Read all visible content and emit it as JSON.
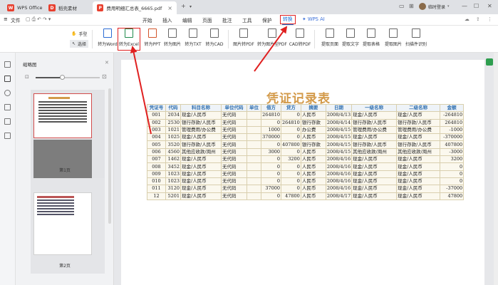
{
  "titlebar": {
    "tabs": [
      {
        "label": "WPS Office",
        "icon": "wps-logo-icon",
        "color": "#e8402f"
      },
      {
        "label": "稻壳素材",
        "icon": "docer-logo-icon",
        "color": "#e8402f"
      },
      {
        "label": "费用明细汇总表_6665.pdf",
        "icon": "pdf-file-icon",
        "color": "#e8402f",
        "active": true
      }
    ],
    "new_tab": "+",
    "user_name": "临时登录"
  },
  "menu": {
    "file_label": "文件",
    "items": [
      "开始",
      "插入",
      "编辑",
      "页面",
      "批注",
      "工具",
      "保护",
      "转换",
      "WPS AI"
    ],
    "active": "转换"
  },
  "toolbar": {
    "hand": "手型",
    "select": "选择",
    "tools_group1": [
      "转为Word",
      "转为Excel",
      "转为PPT",
      "转为图片",
      "转为TXT",
      "转为CAD"
    ],
    "tools_group2": [
      "图片转PDF",
      "转为图片型PDF",
      "CAD转PDF"
    ],
    "tools_group3": [
      "提取页面",
      "提取文字",
      "提取表格",
      "提取图片",
      "扫描件识别"
    ]
  },
  "thumbnails": {
    "title": "缩略图",
    "pages": [
      {
        "label": "第1页",
        "selected": true
      },
      {
        "label": "第2页",
        "selected": false
      }
    ]
  },
  "document": {
    "title": "凭证记录表",
    "headers": [
      "凭证号",
      "代码",
      "科目名称",
      "单位代码",
      "单位",
      "借方",
      "贷方",
      "摘要",
      "日期",
      "一级名称",
      "二级名称",
      "金额"
    ],
    "rows": [
      [
        "001",
        "2034",
        "现金/人民币",
        "无代码",
        "",
        "264810",
        "0",
        "人民币",
        "2008/4/13",
        "现金/人民币",
        "现金/人民币",
        "-264810"
      ],
      [
        "002",
        "2530",
        "银行存款/人民币",
        "无代码",
        "",
        "0",
        "264810",
        "银行存款",
        "2008/4/14",
        "银行存款/人民币",
        "银行存款/人民币",
        "264810"
      ],
      [
        "003",
        "1021",
        "管理费用/办公费",
        "无代码",
        "",
        "1000",
        "0",
        "办公费",
        "2008/4/15",
        "管理费用/办公费",
        "管理费用/办公费",
        "-1000"
      ],
      [
        "004",
        "1025",
        "现金/人民币",
        "无代码",
        "",
        "370000",
        "0",
        "人民币",
        "2008/4/15",
        "现金/人民币",
        "现金/人民币",
        "-370000"
      ],
      [
        "005",
        "3520",
        "银行存款/人民币",
        "无代码",
        "",
        "0",
        "407800",
        "银行存款",
        "2008/4/15",
        "银行存款/人民币",
        "银行存款/人民币",
        "407800"
      ],
      [
        "006",
        "4560",
        "其他应收款/周州",
        "无代码",
        "",
        "3000",
        "0",
        "人民币",
        "2008/4/15",
        "其他应收款/周州",
        "其他应收款/周州",
        "-3000"
      ],
      [
        "007",
        "1462",
        "现金/人民币",
        "无代码",
        "",
        "0",
        "3200",
        "人民币",
        "2008/4/16",
        "现金/人民币",
        "现金/人民币",
        "3200"
      ],
      [
        "008",
        "3452",
        "现金/人民币",
        "无代码",
        "",
        "0",
        "0",
        "人民币",
        "2008/4/16",
        "现金/人民币",
        "现金/人民币",
        "0"
      ],
      [
        "009",
        "1023",
        "现金/人民币",
        "无代码",
        "",
        "0",
        "0",
        "人民币",
        "2008/4/16",
        "现金/人民币",
        "现金/人民币",
        "0"
      ],
      [
        "010",
        "1023",
        "现金/人民币",
        "无代码",
        "",
        "0",
        "0",
        "人民币",
        "2008/4/16",
        "现金/人民币",
        "现金/人民币",
        "0"
      ],
      [
        "011",
        "3120",
        "现金/人民币",
        "无代码",
        "",
        "37000",
        "0",
        "人民币",
        "2008/4/16",
        "现金/人民币",
        "现金/人民币",
        "-37000"
      ],
      [
        "12",
        "5201",
        "现金/人民币",
        "无代码",
        "",
        "0",
        "47800",
        "人民币",
        "2008/4/17",
        "现金/人民币",
        "现金/人民币",
        "47800"
      ]
    ]
  },
  "colors": {
    "accent": "#1a6fd6",
    "highlight": "#e02020",
    "title": "#d39a4a",
    "header_text": "#2f6fb0"
  }
}
